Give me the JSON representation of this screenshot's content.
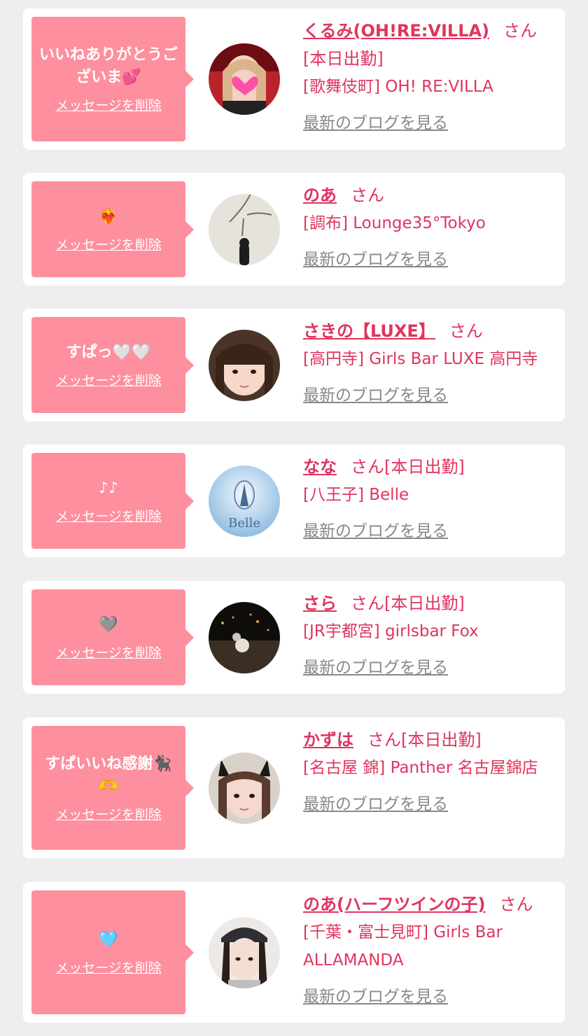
{
  "delete_label": "メッセージを削除",
  "blog_label": "最新のブログを見る",
  "items": [
    {
      "message": "いいねありがとうございま💕",
      "name": "くるみ(OH!RE:VILLA)",
      "suffix": "さん[本日出勤]",
      "shop": "[歌舞伎町] OH! RE:VILLA"
    },
    {
      "message": "❤️‍🔥",
      "name": "のあ",
      "suffix": "さん",
      "shop": "[調布] Lounge35°Tokyo"
    },
    {
      "message": "すぱっ🤍🤍",
      "name": "さきの【LUXE】",
      "suffix": "さん",
      "shop": "[高円寺] Girls Bar LUXE 高円寺"
    },
    {
      "message": "♪♪",
      "name": "なな",
      "suffix": "さん[本日出勤]",
      "shop": "[八王子] Belle",
      "avatar_text": "Belle"
    },
    {
      "message": "🩶",
      "name": "さら",
      "suffix": "さん[本日出勤]",
      "shop": "[JR宇都宮] girlsbar Fox"
    },
    {
      "message": "すぱいいね感謝🐈‍⬛🫶",
      "name": "かずは",
      "suffix": "さん[本日出勤]",
      "shop": "[名古屋 錦] Panther 名古屋錦店"
    },
    {
      "message": "🩵",
      "name": "のあ(ハーフツインの子)",
      "suffix": "さん",
      "shop": "[千葉・富士見町] Girls Bar ALLAMANDA"
    }
  ]
}
